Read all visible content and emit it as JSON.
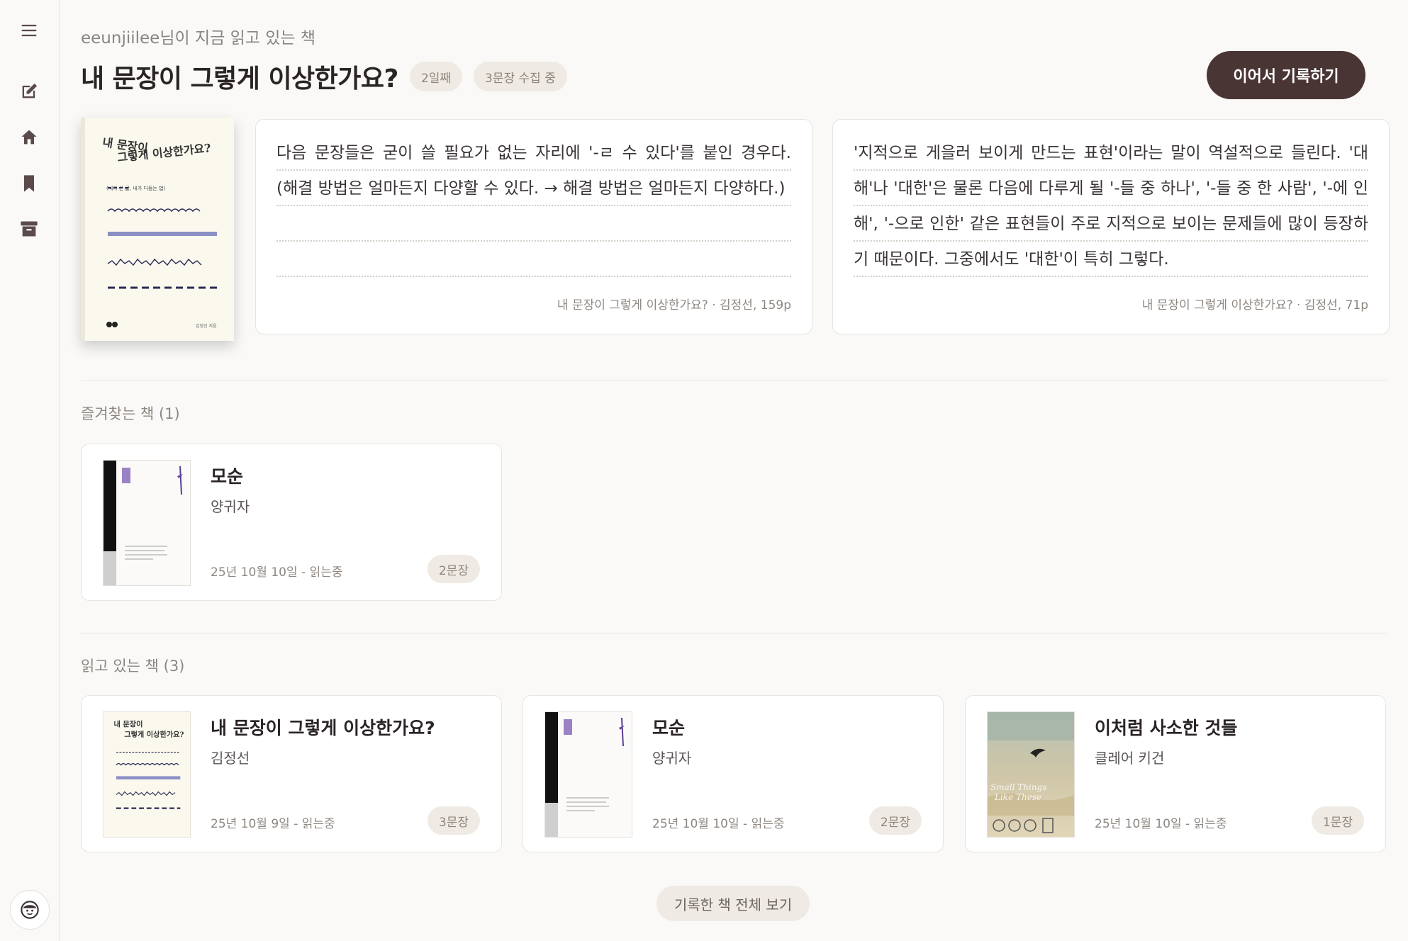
{
  "sidebar": {
    "icons": [
      "menu-icon",
      "edit-icon",
      "home-icon",
      "bookmark-icon",
      "archive-icon"
    ],
    "avatar": "avatar-icon"
  },
  "header": {
    "reader_line": "eeunjiilee님이 지금 읽고 있는 책",
    "title": "내 문장이 그렇게 이상한가요?",
    "chip_days": "2일째",
    "chip_count": "3문장 수집 중",
    "cta_label": "이어서 기록하기"
  },
  "hero": {
    "cover": {
      "title_line1": "내 문장이",
      "title_line2": "그렇게 이상한가요?",
      "subtitle": "(내가 쓴 글, 내가 다듬는 법)",
      "author": "김정선 지음"
    }
  },
  "quotes": [
    {
      "text": "다음 문장들은 굳이 쓸 필요가 없는 자리에 '-ㄹ 수 있다'를 붙인 경우다. (해결 방법은 얼마든지 다양할 수 있다. → 해결 방법은 얼마든지 다양하다.)",
      "source": "내 문장이 그렇게 이상한가요? · 김정선, 159p"
    },
    {
      "text": "'지적으로 게을러 보이게 만드는 표현'이라는 말이 역설적으로 들린다. '대 해'나 '대한'은 물론 다음에 다루게 될 '-들 중 하나', '-들 중 한 사람', '-에 인 해', '-으로 인한' 같은 표현들이 주로 지적으로 보이는 문제들에 많이 등장하 기 때문이다. 그중에서도 '대한'이 특히 그렇다.",
      "source": "내 문장이 그렇게 이상한가요? · 김정선, 71p"
    }
  ],
  "favorites": {
    "label": "즐겨찾는 책 (1)",
    "books": [
      {
        "title": "모순",
        "author": "양귀자",
        "meta": "25년 10월 10일 - 읽는중",
        "badge": "2문장"
      }
    ]
  },
  "reading": {
    "label": "읽고 있는 책 (3)",
    "books": [
      {
        "title": "내 문장이 그렇게 이상한가요?",
        "author": "김정선",
        "meta": "25년 10월 9일 - 읽는중",
        "badge": "3문장"
      },
      {
        "title": "모순",
        "author": "양귀자",
        "meta": "25년 10월 10일 - 읽는중",
        "badge": "2문장"
      },
      {
        "title": "이처럼 사소한 것들",
        "author": "클레어 키건",
        "meta": "25년 10월 10일 - 읽는중",
        "badge": "1문장"
      }
    ]
  },
  "view_all_label": "기록한 책 전체 보기",
  "colors": {
    "cta_bg": "#4a3535",
    "chip_bg": "#efebe4",
    "accent_purple": "#6b4fa0"
  }
}
